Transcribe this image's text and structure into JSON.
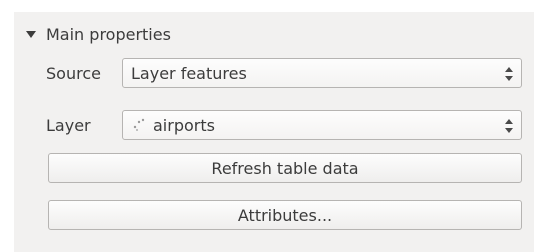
{
  "group": {
    "title": "Main properties",
    "collapse_icon": "triangle-down-icon"
  },
  "source": {
    "label": "Source",
    "value": "Layer features",
    "arrow_icon": "spin-arrows-icon"
  },
  "layer": {
    "label": "Layer",
    "value": "airports",
    "layer_icon": "point-layer-icon",
    "arrow_icon": "spin-arrows-icon"
  },
  "buttons": {
    "refresh_label": "Refresh table data",
    "attributes_label": "Attributes..."
  },
  "colors": {
    "panel_bg": "#f2f1f0",
    "text": "#3c3c3c",
    "border": "#b6b4b2"
  }
}
